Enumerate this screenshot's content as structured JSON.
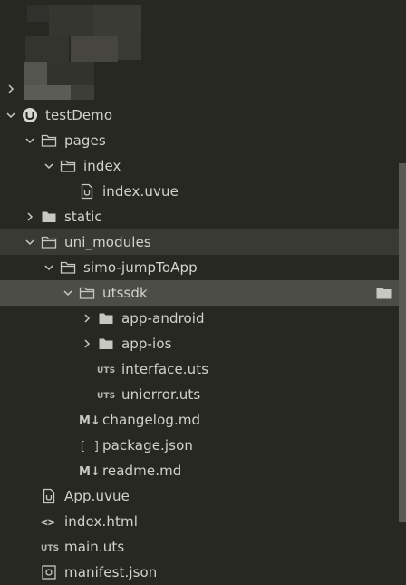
{
  "tree": {
    "collapsed_label": "",
    "project": "testDemo",
    "items": [
      {
        "label": "pages"
      },
      {
        "label": "index"
      },
      {
        "label": "index.uvue"
      },
      {
        "label": "static"
      },
      {
        "label": "uni_modules"
      },
      {
        "label": "simo-jumpToApp"
      },
      {
        "label": "utssdk"
      },
      {
        "label": "app-android"
      },
      {
        "label": "app-ios"
      },
      {
        "label": "interface.uts"
      },
      {
        "label": "unierror.uts"
      },
      {
        "label": "changelog.md"
      },
      {
        "label": "package.json"
      },
      {
        "label": "readme.md"
      },
      {
        "label": "App.uvue"
      },
      {
        "label": "index.html"
      },
      {
        "label": "main.uts"
      },
      {
        "label": "manifest.json"
      }
    ]
  },
  "icons": {
    "uts_badge": "UTS",
    "md_badge": "M↓",
    "json_badge": "[ ]",
    "html_badge": "<>"
  },
  "colors": {
    "background": "#272822",
    "text": "#d2d2cc",
    "icon": "#c8c8c2",
    "active_row": "#4d4d48",
    "parent_row": "#3a3a34"
  }
}
